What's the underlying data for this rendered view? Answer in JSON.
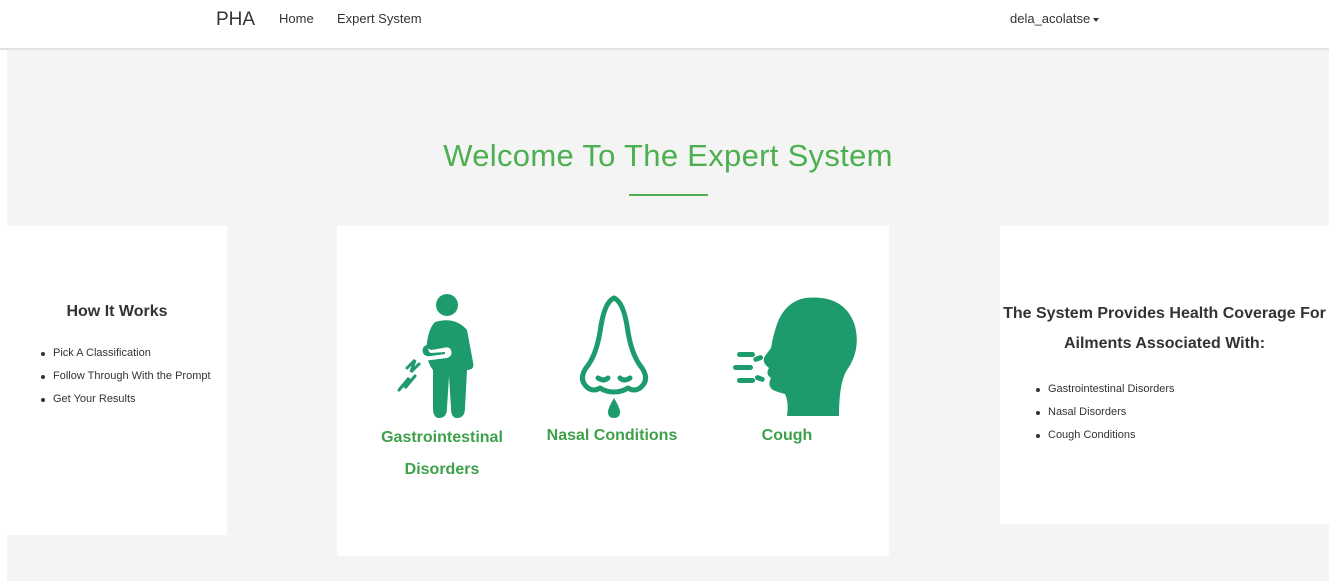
{
  "navbar": {
    "brand": "PHA",
    "links": [
      "Home",
      "Expert System"
    ],
    "user": "dela_acolatse"
  },
  "hero": {
    "title": "Welcome To The Expert System"
  },
  "how_it_works": {
    "title": "How It Works",
    "steps": [
      "Pick A Classification",
      "Follow Through With the Prompt",
      "Get Your Results"
    ]
  },
  "categories": [
    {
      "label": "Gastrointestinal Disorders",
      "icon": "stomach-pain-icon"
    },
    {
      "label": "Nasal Conditions",
      "icon": "nose-drip-icon"
    },
    {
      "label": "Cough",
      "icon": "cough-head-icon"
    }
  ],
  "coverage": {
    "title": "The System Provides Health Coverage For Ailments Associated With:",
    "items": [
      "Gastrointestinal Disorders",
      "Nasal Disorders",
      "Cough Conditions"
    ]
  },
  "colors": {
    "accent": "#4caf50",
    "label_green": "#3ea14a",
    "icon_green": "#1e9b6d",
    "background": "#f4f4f4"
  }
}
